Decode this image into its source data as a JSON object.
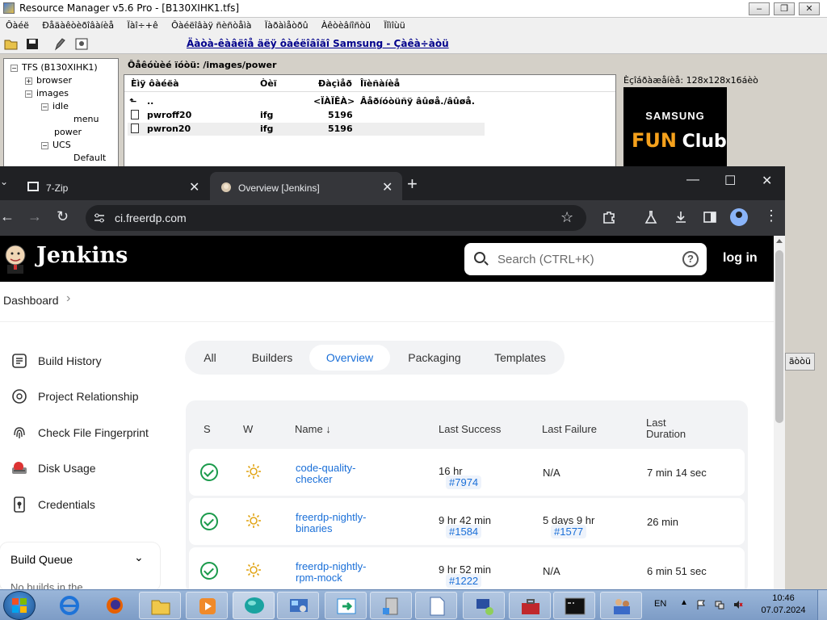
{
  "resource_manager": {
    "title": "Resource Manager v5.6 Pro - [B130XIHK1.tfs]",
    "menu": [
      "Ôàéë",
      "Ðåäàêòèðîâàíèå",
      "Ïàî÷+ê",
      "Ôàéëîâàÿ ñèñòåìà",
      "Ïàðàìåòðû",
      "Àêòèâíîñòü",
      "Ïîìîùü"
    ],
    "window_buttons": [
      "–",
      "❐",
      "✕"
    ],
    "link": "Äàòà-êàâëîå äëÿ ôàéëîâîãî Samsung - Çàêà÷àòü",
    "tree": {
      "root": "TFS (B130XIHK1)",
      "items": [
        "browser",
        "images",
        "idle",
        "menu",
        "power",
        "UCS",
        "Default"
      ]
    },
    "path_label": "Ôåêóùèé ïóòü: /images/power",
    "file_columns": [
      "Èìÿ ôàéëà",
      "Òèï",
      "Ðàçìåð",
      "Îïèñàíèå"
    ],
    "files": [
      {
        "name": "..",
        "type": "",
        "size": "<ÏÀÏÊÀ>",
        "desc": "Âåðíóòüñÿ âûøå./âûøå."
      },
      {
        "name": "pwroff20",
        "type": "ifg",
        "size": "5196",
        "desc": ""
      },
      {
        "name": "pwron20",
        "type": "ifg",
        "size": "5196",
        "desc": ""
      }
    ],
    "preview_label": "Èçîáðàæåíèå: 128x128x16áèò",
    "preview": {
      "brand": "SAMSUNG",
      "fun": "FUN",
      "club": "Club"
    },
    "side_button": "ãòòü"
  },
  "chrome": {
    "tabs": [
      {
        "label": "7-Zip",
        "close": "✕"
      },
      {
        "label": "Overview [Jenkins]",
        "close": "✕"
      }
    ],
    "new_tab": "+",
    "window_controls": [
      "—",
      "☐",
      "✕"
    ],
    "url": "ci.freerdp.com",
    "nav": {
      "back": "←",
      "forward": "→",
      "reload": "↻"
    },
    "star": "☆"
  },
  "jenkins": {
    "brand": "Jenkins",
    "search_placeholder": "Search (CTRL+K)",
    "help": "?",
    "login": "log in",
    "breadcrumb": "Dashboard",
    "breadcrumb_chevron": "›",
    "sidebar": [
      {
        "label": "Build History",
        "icon": "history-icon"
      },
      {
        "label": "Project Relationship",
        "icon": "relationship-icon"
      },
      {
        "label": "Check File Fingerprint",
        "icon": "fingerprint-icon"
      },
      {
        "label": "Disk Usage",
        "icon": "disk-usage-icon"
      },
      {
        "label": "Credentials",
        "icon": "credentials-icon"
      }
    ],
    "build_queue": {
      "title": "Build Queue",
      "chevron": "⌄",
      "sub": "No builds in the"
    },
    "view_tabs": [
      "All",
      "Builders",
      "Overview",
      "Packaging",
      "Templates"
    ],
    "active_tab": "Overview",
    "columns": {
      "s": "S",
      "w": "W",
      "name": "Name ↓",
      "last_success": "Last Success",
      "last_failure": "Last Failure",
      "last_duration_1": "Last",
      "last_duration_2": "Duration"
    },
    "rows": [
      {
        "name_1": "code-quality-",
        "name_2": "checker",
        "last_success": "16 hr",
        "success_build": "#7974",
        "last_failure": "N/A",
        "failure_build": "",
        "duration": "7 min 14 sec"
      },
      {
        "name_1": "freerdp-nightly-",
        "name_2": "binaries",
        "last_success": "9 hr 42 min",
        "success_build": "#1584",
        "last_failure": "5 days 9 hr",
        "failure_build": "#1577",
        "duration": "26 min"
      },
      {
        "name_1": "freerdp-nightly-",
        "name_2": "rpm-mock",
        "last_success": "9 hr 52 min",
        "success_build": "#1222",
        "last_failure": "N/A",
        "failure_build": "",
        "duration": "6 min 51 sec"
      }
    ]
  },
  "taskbar": {
    "apps": [
      "internet-explorer-icon",
      "firefox-icon",
      "explorer-folder-icon",
      "media-player-icon",
      "chat-app-icon",
      "control-panel-icon",
      "remote-desktop-icon",
      "network-drive-icon",
      "document-icon",
      "network-connections-icon",
      "toolbox-icon",
      "command-prompt-icon",
      "users-icon"
    ],
    "lang": "EN",
    "time": "10:46",
    "date": "07.07.2024"
  }
}
